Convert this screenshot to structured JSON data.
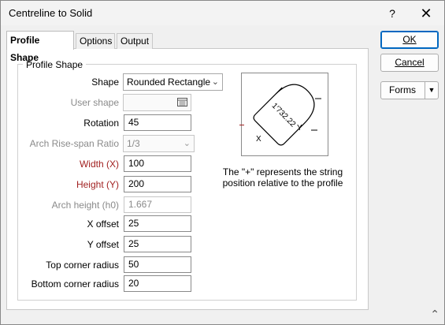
{
  "window": {
    "title": "Centreline to Solid",
    "help_label": "?",
    "close_label": "✕"
  },
  "tabs": [
    {
      "label": "Profile Shape",
      "active": true
    },
    {
      "label": "Options",
      "active": false
    },
    {
      "label": "Output",
      "active": false
    }
  ],
  "group": {
    "title": "Profile Shape"
  },
  "form": {
    "shape": {
      "label": "Shape",
      "value": "Rounded Rectangle"
    },
    "user_shape": {
      "label": "User shape",
      "value": ""
    },
    "rotation": {
      "label": "Rotation",
      "value": "45"
    },
    "arch_ratio": {
      "label": "Arch Rise-span Ratio",
      "value": "1/3"
    },
    "width": {
      "label": "Width (X)",
      "value": "100"
    },
    "height": {
      "label": "Height (Y)",
      "value": "200"
    },
    "arch_height": {
      "label": "Arch height (h0)",
      "value": "1.667"
    },
    "x_offset": {
      "label": "X offset",
      "value": "25"
    },
    "y_offset": {
      "label": "Y offset",
      "value": "25"
    },
    "top_radius": {
      "label": "Top corner radius",
      "value": "50"
    },
    "bottom_radius": {
      "label": "Bottom corner radius",
      "value": "20"
    }
  },
  "preview": {
    "caption_line1": "The \"+\" represents the string",
    "caption_line2": "position relative to the profile",
    "dimension_text": "1′732.22",
    "x_label": "X",
    "y_label": "Y"
  },
  "buttons": {
    "ok": "OK",
    "cancel": "Cancel",
    "forms": "Forms"
  },
  "icons": {
    "help": "help-icon",
    "close": "close-icon",
    "dropdown": "chevron-down-icon",
    "browse": "browse-list-icon",
    "resize": "resize-grip-icon"
  },
  "colors": {
    "required_label": "#a22222",
    "default_button_border": "#0067c0"
  }
}
